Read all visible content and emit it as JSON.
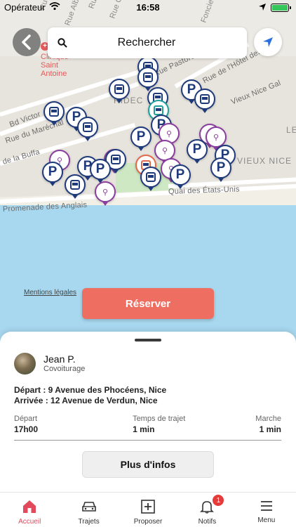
{
  "status_bar": {
    "carrier": "Opérateur",
    "time": "16:58"
  },
  "map": {
    "streets": [
      "Bd Victor",
      "Rue du Maréchal",
      "de la Buffa",
      "Rue Pastorelli",
      "Rue de l'Hôtel des P",
      "Rue Gioffredo",
      "Rue Alberti",
      "Vieux Nice Gal",
      "Rue Gubernatis",
      "Rue Dalpozzo",
      "Promenade des Anglais",
      "Quai des États-Unis",
      "Fonciere"
    ],
    "districts": [
      "VIEUX NICE",
      "RIDEC",
      "LE"
    ],
    "poi": "Clinique Saint Antoine",
    "legal_link": "Mentions légales"
  },
  "search": {
    "placeholder": "Rechercher"
  },
  "reserve_label": "Réserver",
  "ride": {
    "driver_name": "Jean P.",
    "driver_type": "Covoiturage",
    "departure_line": "Départ : 9 Avenue des Phocéens, Nice",
    "arrival_line": "Arrivée : 12 Avenue de Verdun, Nice",
    "columns": [
      {
        "label": "Départ",
        "value": "17h00"
      },
      {
        "label": "Temps de trajet",
        "value": "1 min"
      },
      {
        "label": "Marche",
        "value": "1 min"
      }
    ],
    "more_label": "Plus d'infos"
  },
  "tabs": [
    {
      "label": "Accueil",
      "icon": "home-icon",
      "active": true
    },
    {
      "label": "Trajets",
      "icon": "car-icon"
    },
    {
      "label": "Proposer",
      "icon": "plus-square-icon"
    },
    {
      "label": "Notifs",
      "icon": "bell-icon",
      "badge": "1"
    },
    {
      "label": "Menu",
      "icon": "menu-icon"
    }
  ],
  "colors": {
    "accent": "#ee6e62",
    "tab_active": "#e24a5c",
    "pin_blue": "#1e3a7a",
    "bike_purple": "#8a3e9e",
    "sea": "#a8d8ef"
  }
}
